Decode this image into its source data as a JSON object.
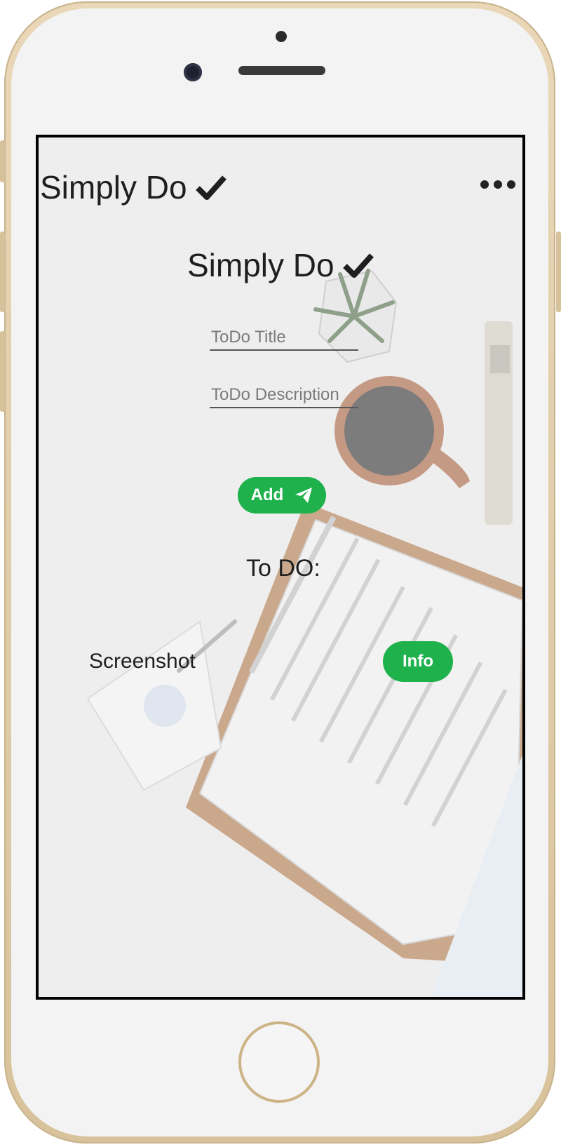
{
  "navbar": {
    "brand": "Simply Do",
    "menu_icon": "ellipsis-icon"
  },
  "main": {
    "title": "Simply Do",
    "title_icon": "check-icon",
    "todo_title_placeholder": "ToDo Title",
    "todo_description_placeholder": "ToDo Description",
    "add_button_label": "Add",
    "add_button_icon": "paper-plane-icon",
    "list_heading": "To DO:",
    "items": [
      {
        "title": "Screenshot",
        "button_label": "Info"
      }
    ]
  },
  "colors": {
    "accent": "#1fb24c",
    "text": "#1f1f1f",
    "device_frame": "#e0cba6"
  }
}
